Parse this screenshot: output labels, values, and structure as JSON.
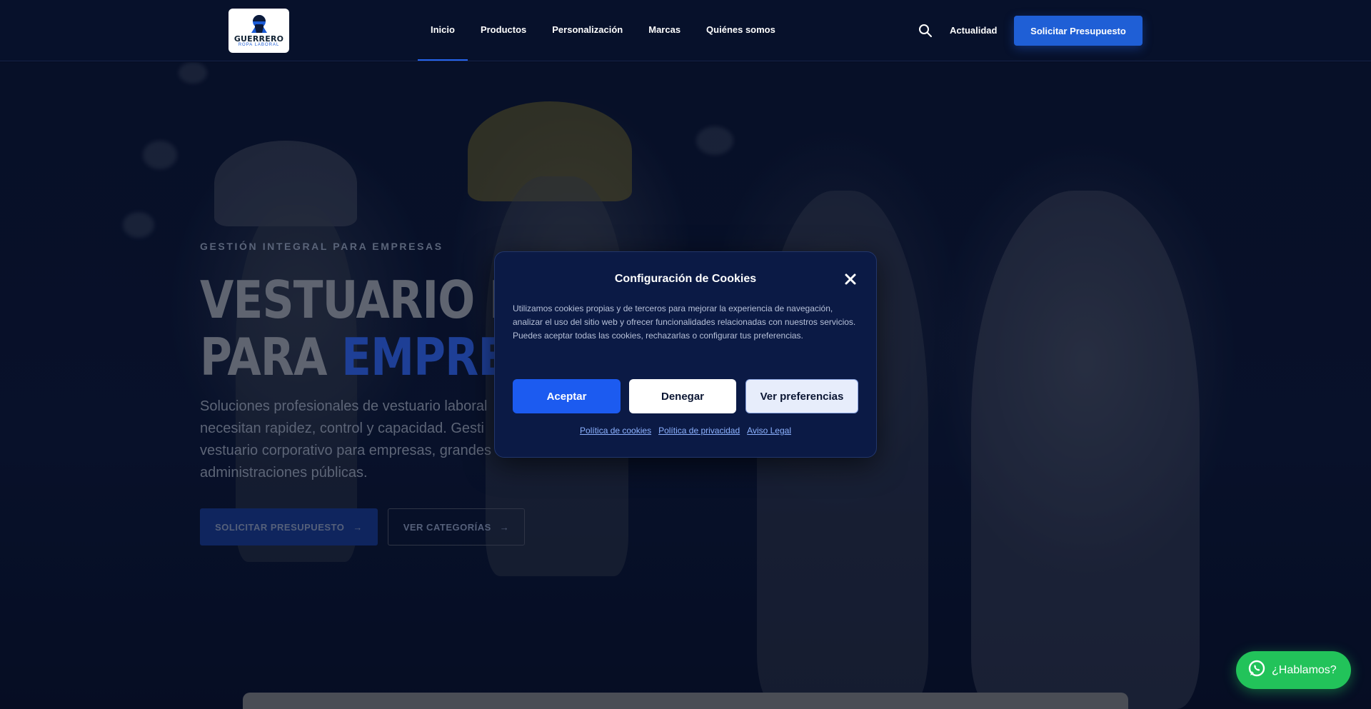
{
  "header": {
    "logo": {
      "name": "GUERRERO",
      "subtitle": "ROPA LABORAL"
    },
    "nav": [
      "Inicio",
      "Productos",
      "Personalización",
      "Marcas",
      "Quiénes somos"
    ],
    "active_nav": "Inicio",
    "search_icon": "search-icon",
    "actualidad": "Actualidad",
    "cta": "Solicitar Presupuesto"
  },
  "hero": {
    "eyebrow": "GESTIÓN INTEGRAL PARA EMPRESAS",
    "title_line1": "VESTUARIO LA",
    "title_line2_plain": "PARA ",
    "title_line2_accent": "EMPRES",
    "description": "Soluciones profesionales de vestuario laboral necesitan rapidez, control y capacidad. Gesti vestuario corporativo para empresas, grandes administraciones públicas.",
    "primary_button": "SOLICITAR PRESUPUESTO",
    "secondary_button": "VER CATEGORÍAS",
    "arrow": "→"
  },
  "cookie": {
    "title": "Configuración de Cookies",
    "text": "Utilizamos cookies propias y de terceros para mejorar la experiencia de navegación, analizar el uso del sitio web y ofrecer funcionalidades relacionadas con nuestros servicios. Puedes aceptar todas las cookies, rechazarlas o configurar tus preferencias.",
    "accept": "Aceptar",
    "deny": "Denegar",
    "preferences": "Ver preferencias",
    "links": [
      "Política de cookies",
      "Política de privacidad",
      "Aviso Legal"
    ],
    "close_icon": "close-icon"
  },
  "whatsapp": {
    "label": "¿Hablamos?",
    "icon": "whatsapp-icon"
  },
  "colors": {
    "accent": "#1f5fd6",
    "modal_bg": "#0b1a45",
    "whatsapp": "#22c35a",
    "header_bg": "#07112b"
  }
}
